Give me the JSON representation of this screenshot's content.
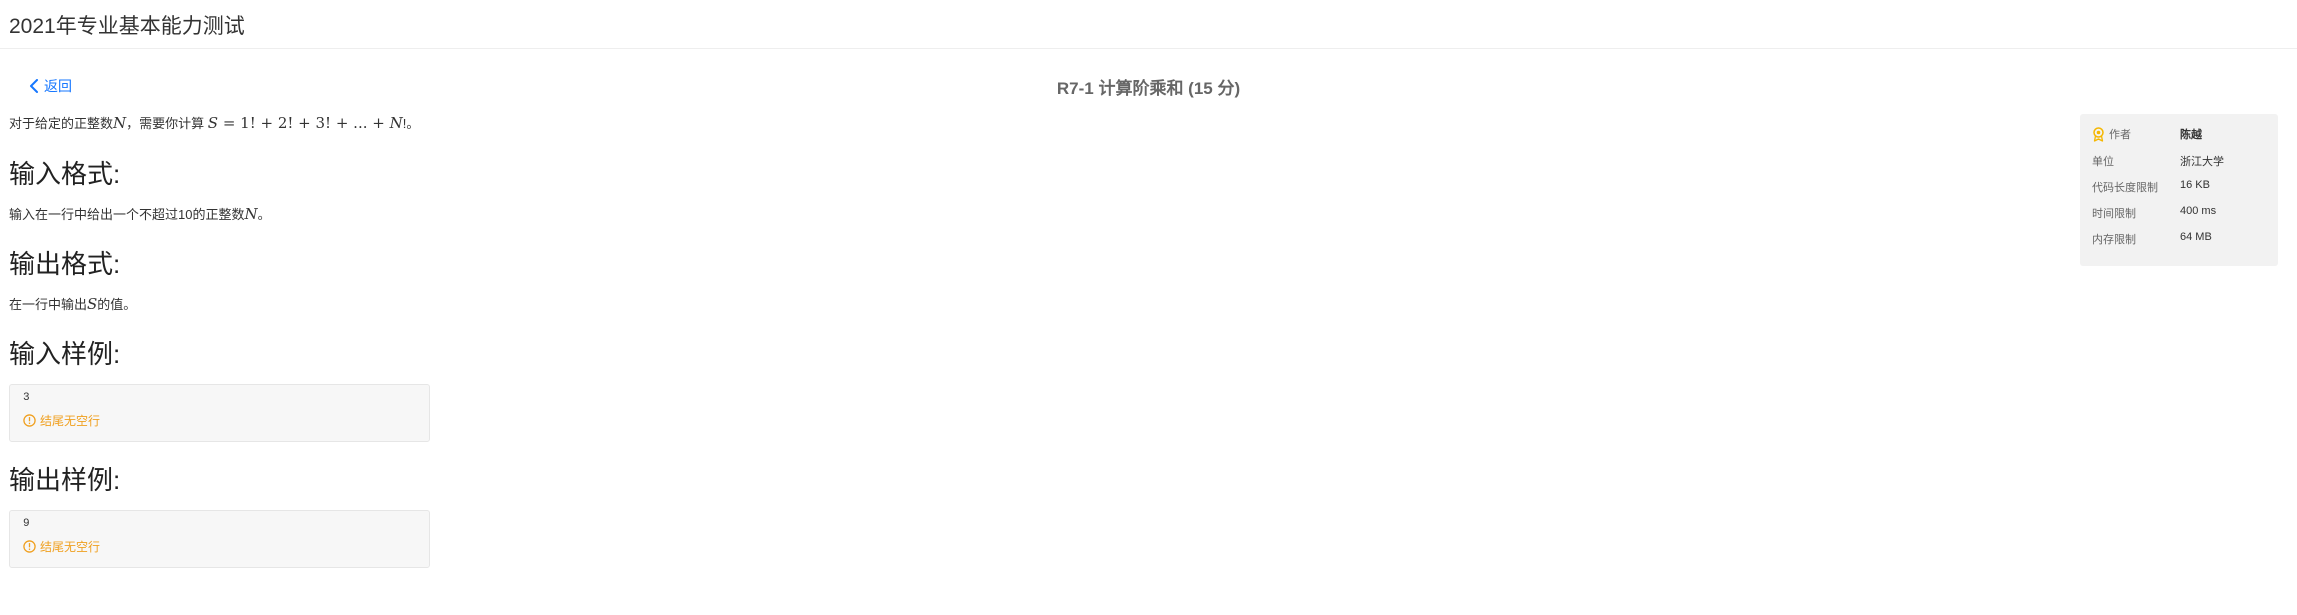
{
  "header": {
    "title": "2021年专业基本能力测试"
  },
  "nav": {
    "back_label": "返回"
  },
  "problem": {
    "title": "R7-1 计算阶乘和 (15 分)",
    "description": {
      "prefix": "对于给定的正整数",
      "var_n": "N",
      "middle": "，需要你计算 ",
      "formula_s": "S",
      "formula_rest": " = 1! + 2! + 3! + ... + ",
      "formula_n": "N",
      "suffix": "!。"
    },
    "input_format": {
      "heading": "输入格式:",
      "text_prefix": "输入在一行中给出一个不超过10的正整数",
      "var": "N",
      "text_suffix": "。"
    },
    "output_format": {
      "heading": "输出格式:",
      "text_prefix": "在一行中输出",
      "var": "S",
      "text_suffix": "的值。"
    },
    "input_sample": {
      "heading": "输入样例:",
      "value": "3",
      "note": "结尾无空行"
    },
    "output_sample": {
      "heading": "输出样例:",
      "value": "9",
      "note": "结尾无空行"
    }
  },
  "info": {
    "author_label": "作者",
    "author_value": "陈越",
    "unit_label": "单位",
    "unit_value": "浙江大学",
    "code_limit_label": "代码长度限制",
    "code_limit_value": "16 KB",
    "time_limit_label": "时间限制",
    "time_limit_value": "400 ms",
    "memory_limit_label": "内存限制",
    "memory_limit_value": "64 MB"
  },
  "colors": {
    "link": "#1677ff",
    "warning": "#f0a020",
    "panel_bg": "#f2f2f2",
    "award_icon": "#f5b700"
  }
}
